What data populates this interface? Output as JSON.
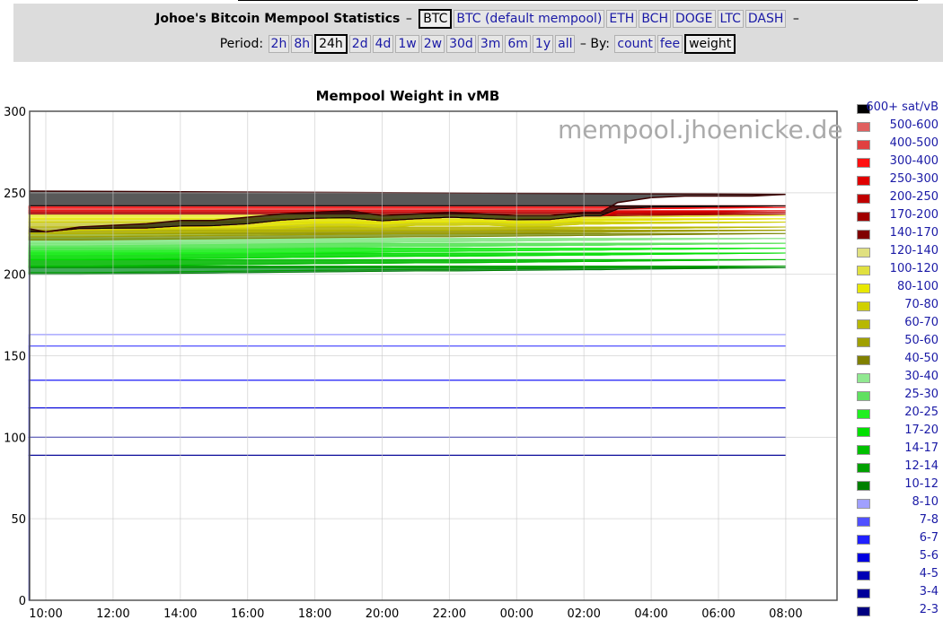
{
  "header": {
    "title": "Johoe's Bitcoin Mempool Statistics",
    "dash": "–",
    "coins": [
      {
        "label": "BTC",
        "active": true
      },
      {
        "label": "BTC (default mempool)",
        "active": false
      },
      {
        "label": "ETH",
        "active": false
      },
      {
        "label": "BCH",
        "active": false
      },
      {
        "label": "DOGE",
        "active": false
      },
      {
        "label": "LTC",
        "active": false
      },
      {
        "label": "DASH",
        "active": false
      }
    ],
    "period_label": "Period:",
    "periods": [
      {
        "label": "2h",
        "active": false
      },
      {
        "label": "8h",
        "active": false
      },
      {
        "label": "24h",
        "active": true
      },
      {
        "label": "2d",
        "active": false
      },
      {
        "label": "4d",
        "active": false
      },
      {
        "label": "1w",
        "active": false
      },
      {
        "label": "2w",
        "active": false
      },
      {
        "label": "30d",
        "active": false
      },
      {
        "label": "3m",
        "active": false
      },
      {
        "label": "6m",
        "active": false
      },
      {
        "label": "1y",
        "active": false
      },
      {
        "label": "all",
        "active": false
      }
    ],
    "by_label": "– By:",
    "metrics": [
      {
        "label": "count",
        "active": false
      },
      {
        "label": "fee",
        "active": false
      },
      {
        "label": "weight",
        "active": true
      }
    ]
  },
  "watermark": "mempool.jhoenicke.de",
  "chart_data": {
    "type": "area",
    "stacked": true,
    "title": "Mempool Weight in vMB",
    "xlabel": "",
    "ylabel": "",
    "ylim": [
      0,
      300
    ],
    "y_ticks": [
      0,
      50,
      100,
      150,
      200,
      250,
      300
    ],
    "x_ticks": [
      "10:00",
      "12:00",
      "14:00",
      "16:00",
      "18:00",
      "20:00",
      "22:00",
      "00:00",
      "02:00",
      "04:00",
      "06:00",
      "08:00"
    ],
    "grid": true,
    "legend_position": "right",
    "x": [
      "09:30",
      "10:00",
      "11:00",
      "12:00",
      "13:00",
      "14:00",
      "15:00",
      "16:00",
      "17:00",
      "18:00",
      "19:00",
      "20:00",
      "21:00",
      "22:00",
      "23:00",
      "00:00",
      "01:00",
      "02:00",
      "02:30",
      "03:00",
      "04:00",
      "05:00",
      "06:00",
      "07:00",
      "08:00",
      "09:30"
    ],
    "total": [
      228,
      226,
      229,
      230,
      231,
      233,
      233,
      235,
      237,
      238,
      239,
      236,
      237,
      238,
      237,
      236,
      236,
      238,
      238,
      244,
      247,
      248,
      248,
      248,
      249,
      251
    ],
    "series": [
      {
        "name": "2-3",
        "color": "#000080",
        "values": [
          89,
          89,
          89,
          89,
          89,
          89,
          89,
          89,
          89,
          89,
          89,
          89,
          89,
          89,
          89,
          89,
          89,
          89,
          89,
          89,
          89,
          89,
          89,
          89,
          89,
          89
        ]
      },
      {
        "name": "3-4",
        "color": "#00009a",
        "values": [
          11,
          11,
          11,
          11,
          11,
          11,
          11,
          11,
          11,
          11,
          11,
          11,
          11,
          11,
          11,
          11,
          11,
          11,
          11,
          11,
          11,
          11,
          11,
          11,
          11,
          11
        ]
      },
      {
        "name": "4-5",
        "color": "#0000b5",
        "values": [
          18,
          18,
          18,
          18,
          18,
          18,
          18,
          18,
          18,
          18,
          18,
          18,
          18,
          18,
          18,
          18,
          18,
          18,
          18,
          18,
          18,
          18,
          18,
          18,
          18,
          18
        ]
      },
      {
        "name": "5-6",
        "color": "#0000e0",
        "values": [
          17,
          17,
          17,
          17,
          17,
          17,
          17,
          17,
          17,
          17,
          17,
          17,
          17,
          17,
          17,
          17,
          17,
          17,
          17,
          17,
          17,
          17,
          17,
          17,
          17,
          17
        ]
      },
      {
        "name": "6-7",
        "color": "#2020ff",
        "values": [
          21,
          21,
          21,
          21,
          21,
          21,
          21,
          21,
          21,
          21,
          21,
          21,
          21,
          21,
          21,
          21,
          21,
          21,
          21,
          21,
          21,
          21,
          21,
          21,
          21,
          21
        ]
      },
      {
        "name": "7-8",
        "color": "#5050ff",
        "values": [
          7,
          7,
          7,
          7,
          7,
          7,
          7,
          7,
          7,
          7,
          7,
          7,
          7,
          7,
          7,
          7,
          7,
          7,
          7,
          7,
          7,
          7,
          7,
          7,
          7,
          7
        ]
      },
      {
        "name": "8-10",
        "color": "#a0a0ff",
        "values": [
          37,
          37,
          37,
          37.2,
          37.4,
          37.6,
          37.8,
          38,
          38.2,
          38.4,
          38.6,
          38.8,
          39,
          39,
          39.2,
          39.4,
          39.6,
          39.8,
          39.8,
          40,
          40.2,
          40.4,
          40.6,
          40.8,
          41,
          41
        ]
      },
      {
        "name": "10-12",
        "color": "#008000",
        "values": [
          1,
          1,
          1,
          1,
          1,
          1,
          1,
          1,
          1,
          1,
          1,
          1,
          1,
          1,
          1,
          1,
          1,
          1,
          1,
          1,
          1,
          1,
          1,
          1,
          1,
          1
        ]
      },
      {
        "name": "12-14",
        "color": "#00a000",
        "values": [
          4,
          4,
          4,
          4,
          4,
          4,
          4,
          4,
          4,
          4,
          4,
          4,
          4,
          4,
          4,
          4,
          4,
          4,
          4,
          4,
          4,
          4,
          4,
          4,
          4,
          4
        ]
      },
      {
        "name": "14-17",
        "color": "#00c000",
        "values": [
          4,
          4,
          4,
          4,
          4,
          4,
          4,
          4,
          4,
          4,
          4,
          4,
          4,
          4,
          4,
          4,
          4,
          4,
          4,
          4,
          4,
          4,
          4,
          4,
          4,
          4
        ]
      },
      {
        "name": "17-20",
        "color": "#00e000",
        "values": [
          3,
          3,
          3,
          3,
          3,
          3,
          3,
          3,
          3,
          3,
          3,
          3,
          3,
          3,
          3,
          3,
          3,
          3,
          3,
          3,
          3,
          3,
          3,
          3,
          3,
          3
        ]
      },
      {
        "name": "20-25",
        "color": "#20f020",
        "values": [
          3,
          3,
          3,
          3,
          3,
          3,
          3,
          3,
          3,
          3,
          3,
          3,
          3,
          3,
          3,
          3,
          3,
          3,
          3,
          3,
          3,
          3,
          3,
          3,
          3,
          3
        ]
      },
      {
        "name": "25-30",
        "color": "#60e060",
        "values": [
          3,
          3,
          3,
          3,
          3,
          3,
          3,
          3,
          3,
          3,
          3,
          3,
          3,
          3,
          3,
          3,
          3,
          3,
          3,
          3,
          3,
          3,
          3,
          3,
          3,
          3
        ]
      },
      {
        "name": "30-40",
        "color": "#90e890",
        "values": [
          3,
          3,
          3,
          3,
          3,
          3,
          3,
          3,
          3,
          3,
          3,
          3,
          3,
          3,
          3,
          3,
          3,
          3,
          3,
          3,
          3,
          3,
          3,
          3,
          3,
          3
        ]
      },
      {
        "name": "40-50",
        "color": "#808000",
        "values": [
          2,
          2,
          2,
          2,
          2,
          2,
          2,
          2,
          2,
          2,
          2,
          2,
          2,
          2,
          2,
          2,
          2,
          2,
          2,
          2,
          2,
          2,
          2,
          2,
          2,
          2
        ]
      },
      {
        "name": "50-60",
        "color": "#a0a000",
        "values": [
          2,
          2,
          2,
          2,
          2,
          2,
          2,
          2,
          2,
          2,
          2,
          2,
          2,
          2,
          2,
          2,
          2,
          2,
          2,
          2,
          2,
          2,
          2,
          2,
          2,
          2
        ]
      },
      {
        "name": "60-70",
        "color": "#b8b800",
        "values": [
          1,
          1,
          2,
          2,
          2,
          2,
          2,
          2,
          2,
          3,
          3,
          2,
          3,
          3,
          3,
          2,
          2,
          3,
          3,
          3,
          3,
          3,
          3,
          3,
          3,
          3
        ]
      },
      {
        "name": "70-80",
        "color": "#d0d000",
        "values": [
          0,
          0,
          1,
          1,
          1,
          1,
          1,
          1,
          2,
          2,
          2,
          2,
          2,
          2,
          2,
          2,
          2,
          2,
          2,
          2,
          2,
          2,
          2,
          2,
          2,
          2
        ]
      },
      {
        "name": "80-100",
        "color": "#e8e800",
        "values": [
          0,
          0,
          0,
          0,
          0,
          1,
          1,
          2,
          3,
          3,
          3,
          2,
          2,
          3,
          2,
          2,
          2,
          2,
          2,
          2,
          2,
          2,
          2,
          2,
          2,
          2
        ]
      },
      {
        "name": "100-120",
        "color": "#e0e040",
        "values": [
          0,
          0,
          0,
          0,
          0,
          0,
          0,
          0,
          0,
          0,
          0,
          0,
          0,
          0,
          0,
          0,
          0,
          1,
          1,
          1,
          1,
          1,
          1,
          1,
          1,
          1
        ]
      },
      {
        "name": "120-140",
        "color": "#e0e080",
        "values": [
          0,
          0,
          0,
          0,
          0,
          0,
          0,
          0,
          0,
          0,
          0,
          0,
          0,
          0,
          0,
          0,
          0,
          0,
          0,
          0,
          0,
          0,
          0,
          0,
          0,
          0
        ]
      },
      {
        "name": "140-170",
        "color": "#800000",
        "values": [
          0,
          0,
          0,
          0,
          0,
          0,
          0,
          0,
          0,
          0,
          0,
          0,
          0,
          0,
          0,
          0,
          0,
          0,
          0,
          0,
          0,
          0,
          0,
          0,
          0,
          0
        ]
      },
      {
        "name": "170-200",
        "color": "#a00000",
        "values": [
          0,
          0,
          0,
          0,
          0,
          0,
          0,
          0,
          0,
          0,
          0,
          0,
          0,
          0,
          0,
          0,
          0,
          0,
          0,
          1,
          1,
          1,
          1,
          1,
          1,
          1
        ]
      },
      {
        "name": "200-250",
        "color": "#c00000",
        "values": [
          0,
          0,
          0,
          0,
          0,
          0,
          0,
          0,
          0,
          0,
          0,
          0,
          0,
          0,
          0,
          0,
          0,
          0,
          0,
          1,
          1,
          1,
          1,
          1,
          1,
          1
        ]
      },
      {
        "name": "250-300",
        "color": "#e00000",
        "values": [
          0,
          0,
          0,
          0,
          0,
          0,
          0,
          0,
          0,
          0,
          0,
          0,
          0,
          0,
          0,
          0,
          0,
          0,
          0,
          2,
          2,
          2,
          2,
          2,
          2,
          2
        ]
      },
      {
        "name": "300-400",
        "color": "#ff1010",
        "values": [
          0,
          0,
          0,
          0,
          0,
          0,
          0,
          0,
          0,
          0,
          0,
          0,
          0,
          0,
          0,
          0,
          0,
          0,
          0,
          0,
          1,
          1,
          1,
          1,
          1,
          1
        ]
      },
      {
        "name": "400-500",
        "color": "#e04040",
        "values": [
          0,
          0,
          0,
          0,
          0,
          0,
          0,
          0,
          0,
          0,
          0,
          0,
          0,
          0,
          0,
          0,
          0,
          0,
          0,
          0,
          0,
          0,
          0,
          0,
          0,
          0
        ]
      },
      {
        "name": "500-600",
        "color": "#e06060",
        "values": [
          0,
          0,
          0,
          0,
          0,
          0,
          0,
          0,
          0,
          0,
          0,
          0,
          0,
          0,
          0,
          0,
          0,
          0,
          0,
          0,
          0,
          0,
          0,
          0,
          0,
          0
        ]
      },
      {
        "name": "600+ sat/vB",
        "color": "#000000",
        "values": [
          0,
          0,
          0,
          0,
          0,
          0,
          0,
          0,
          0,
          0,
          0,
          0,
          0,
          0,
          0,
          0,
          0,
          0,
          0,
          0,
          0,
          0,
          0,
          0,
          0,
          0
        ]
      }
    ]
  }
}
